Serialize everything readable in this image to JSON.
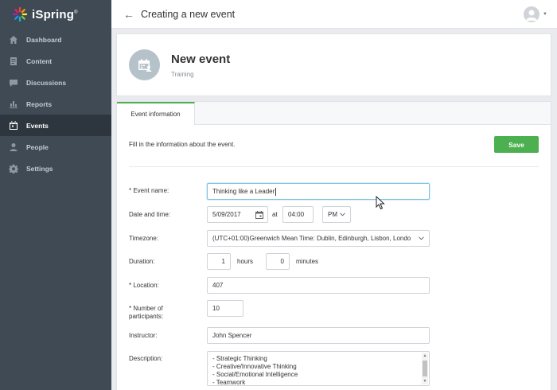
{
  "brand": {
    "name": "iSpring",
    "mark": "®"
  },
  "sidebar": {
    "items": [
      {
        "label": "Dashboard",
        "icon": "home-icon",
        "active": false
      },
      {
        "label": "Content",
        "icon": "document-icon",
        "active": false
      },
      {
        "label": "Discussions",
        "icon": "chat-icon",
        "active": false
      },
      {
        "label": "Reports",
        "icon": "bar-chart-icon",
        "active": false
      },
      {
        "label": "Events",
        "icon": "calendar-icon",
        "active": true
      },
      {
        "label": "People",
        "icon": "person-icon",
        "active": false
      },
      {
        "label": "Settings",
        "icon": "gear-icon",
        "active": false
      }
    ]
  },
  "topbar": {
    "back_icon": "←",
    "title": "Creating a new event"
  },
  "header": {
    "title": "New event",
    "subtitle": "Training"
  },
  "tabs": [
    {
      "label": "Event information",
      "active": true
    }
  ],
  "form": {
    "intro": "Fill in the information about the event.",
    "save_label": "Save",
    "event_name": {
      "label": "* Event name:",
      "value": "Thinking like a Leader"
    },
    "date_time": {
      "label": "Date and time:",
      "date": "5/09/2017",
      "at": "at",
      "time": "04:00",
      "ampm": "PM"
    },
    "timezone": {
      "label": "Timezone:",
      "value": "(UTC+01:00)Greenwich Mean Time: Dublin, Edinburgh, Lisbon, Londo"
    },
    "duration": {
      "label": "Duration:",
      "hours": "1",
      "hours_label": "hours",
      "minutes": "0",
      "minutes_label": "minutes"
    },
    "location": {
      "label": "* Location:",
      "value": "407"
    },
    "participants": {
      "label_line1": "* Number of",
      "label_line2": "participants:",
      "value": "10"
    },
    "instructor": {
      "label": "Instructor:",
      "value": "John Spencer"
    },
    "description": {
      "label": "Description:",
      "lines": [
        "- Strategic Thinking",
        "- Creative/Innovative Thinking",
        "- Social/Emotional Intelligence",
        "- Teamwork"
      ]
    }
  },
  "colors": {
    "sidebar_bg": "#3f4a55",
    "sidebar_active": "#2d353e",
    "accent_green": "#4caf50",
    "focus_blue": "#7cc4e4"
  }
}
